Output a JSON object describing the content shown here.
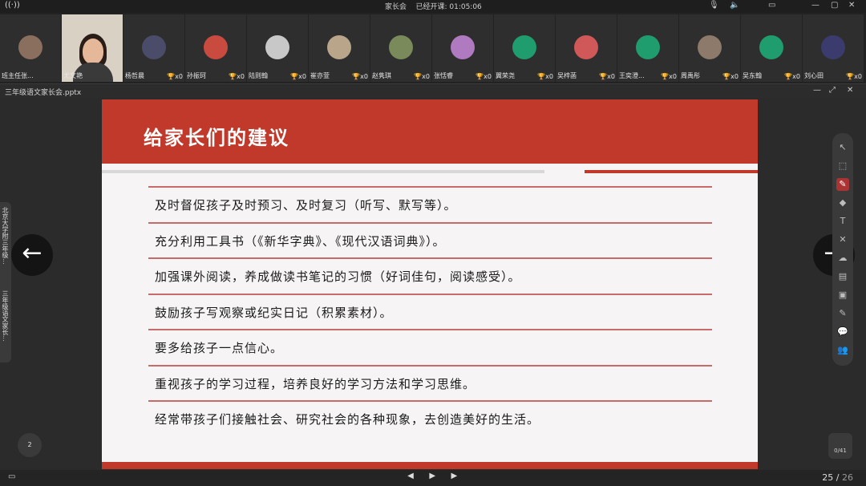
{
  "titlebar": {
    "meeting_label": "家长会",
    "status_text": "已经开课: 01:05:06",
    "mic_icon": "mic-icon",
    "minimize": "—",
    "maximize": "▢",
    "close": "✕"
  },
  "participants": [
    {
      "name": "班主任张...",
      "type": "photo",
      "color": "#8a6f5e",
      "cup": ""
    },
    {
      "name": "尤文艳",
      "type": "video",
      "color": "#d9d2c4",
      "cup": ""
    },
    {
      "name": "杨哲晨",
      "type": "photo",
      "color": "#4b4b6a",
      "cup": "x0"
    },
    {
      "name": "孙振珂",
      "type": "photo",
      "color": "#c94b3f",
      "cup": "x0"
    },
    {
      "name": "陆则翰",
      "type": "gray",
      "color": "#c8c8c8",
      "cup": "x0"
    },
    {
      "name": "崔亦萱",
      "type": "photo",
      "color": "#b8a58a",
      "cup": "x0"
    },
    {
      "name": "赵隽琪",
      "type": "photo",
      "color": "#7a8a5a",
      "cup": "x0"
    },
    {
      "name": "张恬睿",
      "type": "photo",
      "color": "#b07ac0",
      "cup": "x0"
    },
    {
      "name": "翼荣尧",
      "type": "green",
      "color": "#1f9d6e",
      "cup": "x0"
    },
    {
      "name": "吴梓菡",
      "type": "photo",
      "color": "#d05858",
      "cup": "x0"
    },
    {
      "name": "王奕澄...",
      "type": "green",
      "color": "#1f9d6e",
      "cup": "x0"
    },
    {
      "name": "周禹彤",
      "type": "photo",
      "color": "#8d7a6a",
      "cup": "x0"
    },
    {
      "name": "吴东翰",
      "type": "green",
      "color": "#1f9d6e",
      "cup": "x0"
    },
    {
      "name": "刘心田",
      "type": "photo",
      "color": "#3b3b6e",
      "cup": "x0"
    }
  ],
  "docbar": {
    "title": "三年级语文家长会.pptx"
  },
  "slide": {
    "title": "给家长们的建议",
    "items": [
      "及时督促孩子及时预习、及时复习（听写、默写等）。",
      "充分利用工具书（《新华字典》、《现代汉语词典》）。",
      "加强课外阅读，养成做读书笔记的习惯（好词佳句，阅读感受）。",
      "鼓励孩子写观察或纪实日记（积累素材）。",
      "要多给孩子一点信心。",
      "重视孩子的学习过程，培养良好的学习方法和学习思维。",
      "经常带孩子们接触社会、研究社会的各种现象，去创造美好的生活。"
    ]
  },
  "sidetabs": {
    "tab1": "北京大学附三年级...",
    "tab2": "三年级语文家长..."
  },
  "nav": {
    "prev": "←",
    "next": "→"
  },
  "tools": [
    "↖",
    "⬚",
    "✎",
    "◆",
    "T",
    "✕",
    "☁",
    "▤",
    "▣",
    "✎",
    "💬",
    "👥"
  ],
  "badge": {
    "page_count": "2",
    "counter": "0/41"
  },
  "bottom": {
    "current": "25",
    "separator": "/",
    "total": "26",
    "prev_icon": "◀",
    "play_icon": "▶",
    "next_icon": "▶"
  }
}
